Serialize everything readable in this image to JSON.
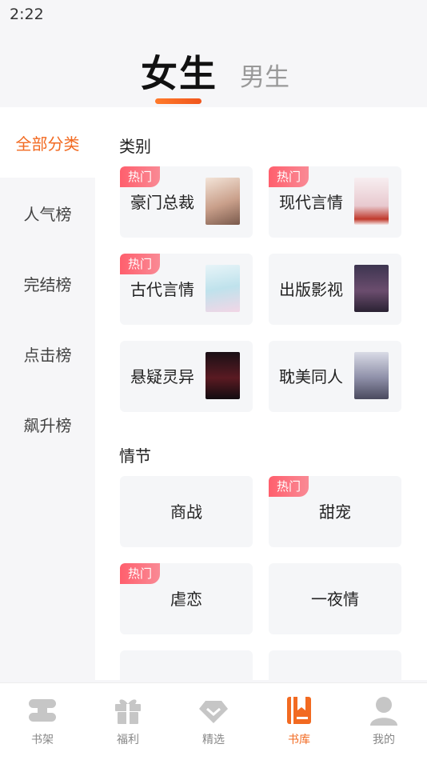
{
  "status": {
    "time": "2:22"
  },
  "gender_tabs": {
    "female": "女生",
    "male": "男生",
    "active": "female"
  },
  "sidebar": {
    "items": [
      {
        "label": "全部分类",
        "active": true
      },
      {
        "label": "人气榜"
      },
      {
        "label": "完结榜"
      },
      {
        "label": "点击榜"
      },
      {
        "label": "飙升榜"
      }
    ]
  },
  "sections": {
    "category": {
      "title": "类别",
      "cards": [
        {
          "label": "豪门总裁",
          "hot": "热门"
        },
        {
          "label": "现代言情",
          "hot": "热门"
        },
        {
          "label": "古代言情",
          "hot": "热门"
        },
        {
          "label": "出版影视"
        },
        {
          "label": "悬疑灵异"
        },
        {
          "label": "耽美同人"
        }
      ]
    },
    "plot": {
      "title": "情节",
      "cards": [
        {
          "label": "商战"
        },
        {
          "label": "甜宠",
          "hot": "热门"
        },
        {
          "label": "虐恋",
          "hot": "热门"
        },
        {
          "label": "一夜情"
        }
      ]
    }
  },
  "bottom_nav": {
    "items": [
      {
        "label": "书架",
        "icon": "bookshelf-icon"
      },
      {
        "label": "福利",
        "icon": "gift-icon"
      },
      {
        "label": "精选",
        "icon": "diamond-icon"
      },
      {
        "label": "书库",
        "icon": "library-icon",
        "active": true
      },
      {
        "label": "我的",
        "icon": "profile-icon"
      }
    ]
  },
  "colors": {
    "accent": "#f26a21",
    "hot_badge": "#ff5f6d",
    "card_bg": "#f5f6f8"
  }
}
